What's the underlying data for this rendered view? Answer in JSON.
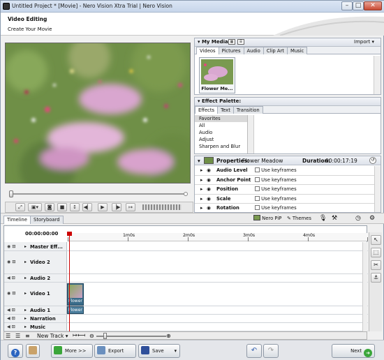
{
  "window": {
    "title": "Untitled Project * [Movie] - Nero Vision Xtra Trial | Nero Vision"
  },
  "header": {
    "title": "Video Editing",
    "subtitle": "Create Your Movie"
  },
  "media": {
    "title": "My Media",
    "import_label": "Import",
    "tabs": [
      "Videos",
      "Pictures",
      "Audio",
      "Clip Art",
      "Music"
    ],
    "active_tab": "Videos",
    "thumb_label": "Flower Me..."
  },
  "effects": {
    "title": "Effect Palette:",
    "tabs": [
      "Effects",
      "Text",
      "Transition"
    ],
    "active_tab": "Effects",
    "items": [
      "Favorites",
      "All",
      "Audio",
      "Adjust",
      "Sharpen and Blur"
    ],
    "selected": "Favorites"
  },
  "properties": {
    "label": "Properties:",
    "clip_name": "Flower Meadow",
    "duration_label": "Duration:",
    "duration": "00:00:17:19",
    "rows": [
      {
        "name": "Audio Level",
        "kf": "Use keyframes"
      },
      {
        "name": "Anchor Point",
        "kf": "Use keyframes"
      },
      {
        "name": "Position",
        "kf": "Use keyframes"
      },
      {
        "name": "Scale",
        "kf": "Use keyframes"
      },
      {
        "name": "Rotation",
        "kf": "Use keyframes"
      }
    ]
  },
  "midbar": {
    "timeline_tab": "Timeline",
    "storyboard_tab": "Storyboard",
    "pip_label": "Nero PiP",
    "themes_label": "Themes"
  },
  "timeline": {
    "timecode": "00:00:00:00",
    "ruler": [
      "1m0s",
      "2m0s",
      "3m0s",
      "4m0s"
    ],
    "tracks": [
      {
        "name": "Master Eff..."
      },
      {
        "name": "Video 2"
      },
      {
        "name": "Audio 2"
      },
      {
        "name": "Video 1"
      },
      {
        "name": "Audio 1"
      },
      {
        "name": "Narration"
      },
      {
        "name": "Music"
      }
    ],
    "clip_video": "Flower",
    "clip_audio": "Flower",
    "new_track": "New Track"
  },
  "bottom": {
    "more": "More >>",
    "export": "Export",
    "save": "Save",
    "next": "Next"
  },
  "colors": {
    "accent_green": "#3aa63a",
    "clip_blue": "#3a6c8a",
    "playhead": "#cc0000"
  }
}
